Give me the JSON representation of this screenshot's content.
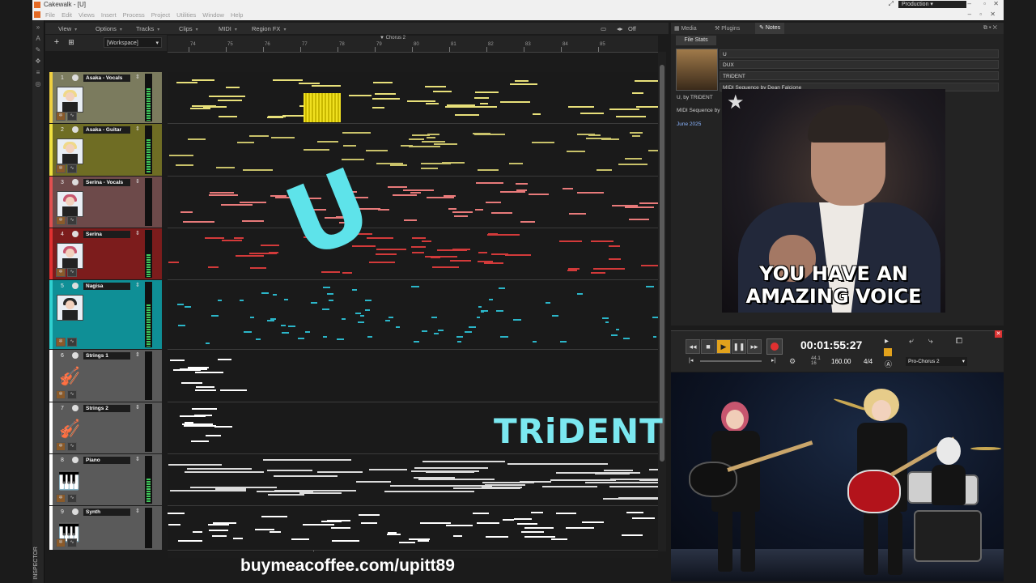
{
  "window": {
    "title": "Cakewalk - [U]",
    "workspace": "Production"
  },
  "menu": [
    "File",
    "Edit",
    "Views",
    "Insert",
    "Process",
    "Project",
    "Utilities",
    "Window",
    "Help"
  ],
  "trackview_menu": [
    {
      "label": "View"
    },
    {
      "label": "Options"
    },
    {
      "label": "Tracks"
    },
    {
      "label": "Clips"
    },
    {
      "label": "MIDI"
    },
    {
      "label": "Region FX"
    }
  ],
  "snap": {
    "label": "Off"
  },
  "workspace_select": "[Workspace]",
  "ruler": {
    "marker": "Chorus 2",
    "ticks": [
      "74",
      "75",
      "76",
      "77",
      "78",
      "79",
      "80",
      "81",
      "82",
      "83",
      "84",
      "85"
    ]
  },
  "tracks": [
    {
      "num": "1",
      "name": "Asaka - Vocals",
      "color": "#f0d040",
      "bg": "#7b7b5e",
      "lane_notes": "#e8e07a"
    },
    {
      "num": "2",
      "name": "Asaka - Guitar",
      "color": "#f0e040",
      "bg": "#6f6d24",
      "lane_notes": "#c9c26a"
    },
    {
      "num": "3",
      "name": "Serina - Vocals",
      "color": "#e05050",
      "bg": "#6d4a4a",
      "lane_notes": "#e87a7a"
    },
    {
      "num": "4",
      "name": "Serina",
      "color": "#e03030",
      "bg": "#7c1c1c",
      "lane_notes": "#d33a3a"
    },
    {
      "num": "5",
      "name": "Nagisa",
      "color": "#30d0d0",
      "bg": "#0f8f96",
      "lane_notes": "#2bb6c9"
    },
    {
      "num": "6",
      "name": "Strings 1",
      "color": "#ffffff",
      "bg": "#5a5a5a",
      "lane_notes": "#ffffff"
    },
    {
      "num": "7",
      "name": "Strings 2",
      "color": "#ffffff",
      "bg": "#5a5a5a",
      "lane_notes": "#ffffff"
    },
    {
      "num": "8",
      "name": "Piano",
      "color": "#ffffff",
      "bg": "#5a5a5a",
      "lane_notes": "#dcdcdc"
    },
    {
      "num": "9",
      "name": "Synth",
      "color": "#ffffff",
      "bg": "#5a5a5a",
      "lane_notes": "#ffffff"
    }
  ],
  "overlay": {
    "big_letter": "U",
    "band_name": "TRiDENT",
    "footer": "buymeacoffee.com/upitt89"
  },
  "dock": {
    "tabs": [
      "Media",
      "Plugins",
      "Notes"
    ],
    "subtab": "File Stats",
    "fields": [
      "U",
      "DUX",
      "TRiDENT",
      "MIDI Sequence by Dean Falcione"
    ],
    "notes": [
      "U, by TRiDENT",
      "MIDI Sequence by",
      "June 2025"
    ]
  },
  "meme": {
    "line1": "YOU HAVE AN",
    "line2": "AMAZING VOICE"
  },
  "transport": {
    "time": "00:01:55:27",
    "tempo": "160.00",
    "meter": "4/4",
    "sample_rate": "44.1",
    "bit_depth": "16",
    "marker": "Pro-Chorus 2"
  },
  "icons": {
    "rewind": "rewind-icon",
    "stop": "stop-icon",
    "play": "play-icon",
    "pause": "pause-icon",
    "ffwd": "fast-forward-icon",
    "record": "record-icon"
  }
}
